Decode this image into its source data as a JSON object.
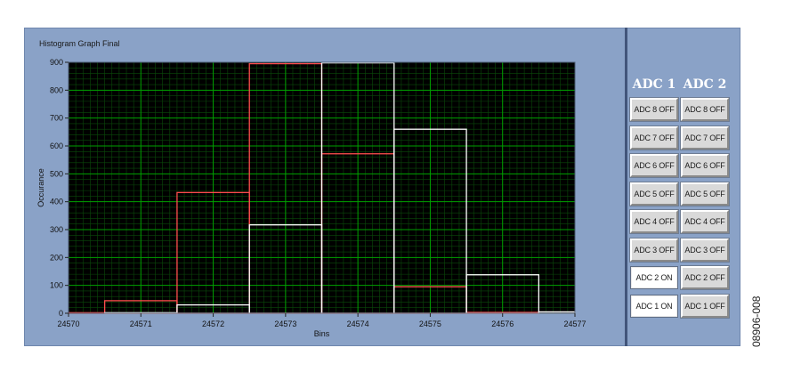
{
  "graph": {
    "title": "Histogram Graph Final"
  },
  "chart_data": {
    "type": "bar",
    "title": "Histogram Graph Final",
    "xlabel": "Bins",
    "ylabel": "Occurance",
    "xlim": [
      24570,
      24577
    ],
    "ylim": [
      0,
      900
    ],
    "x_ticks": [
      "24570",
      "24571",
      "24572",
      "24573",
      "24574",
      "24575",
      "24576",
      "24577"
    ],
    "y_ticks": [
      "0",
      "100",
      "200",
      "300",
      "400",
      "500",
      "600",
      "700",
      "800",
      "900"
    ],
    "grid": true,
    "series": [
      {
        "color": "#ff4d4d",
        "bins": [
          24570,
          24571,
          24572,
          24573,
          24574,
          24575,
          24576
        ],
        "values": [
          2,
          45,
          433,
          895,
          572,
          95,
          3
        ]
      },
      {
        "color": "#ffffff",
        "bins": [
          24571,
          24572,
          24573,
          24574,
          24575,
          24576,
          24577
        ],
        "values": [
          2,
          30,
          317,
          898,
          660,
          138,
          5
        ]
      }
    ],
    "plot_background": "#000000",
    "grid_color": "#00a000"
  },
  "adc_panel": {
    "col1_header": "ADC 1",
    "col2_header": "ADC 2",
    "adc1_buttons": [
      "ADC 8 OFF",
      "ADC 7 OFF",
      "ADC 6 OFF",
      "ADC 5 OFF",
      "ADC 4 OFF",
      "ADC 3 OFF",
      "ADC 2 ON",
      "ADC 1 ON"
    ],
    "adc2_buttons": [
      "ADC 8 OFF",
      "ADC 7 OFF",
      "ADC 6 OFF",
      "ADC 5 OFF",
      "ADC 4 OFF",
      "ADC 3 OFF",
      "ADC 2 OFF",
      "ADC 1 OFF"
    ],
    "adc1_states": [
      "off",
      "off",
      "off",
      "off",
      "off",
      "off",
      "on",
      "on"
    ],
    "adc2_states": [
      "off",
      "off",
      "off",
      "off",
      "off",
      "off",
      "off",
      "off"
    ]
  },
  "figure_code": "08906-008"
}
